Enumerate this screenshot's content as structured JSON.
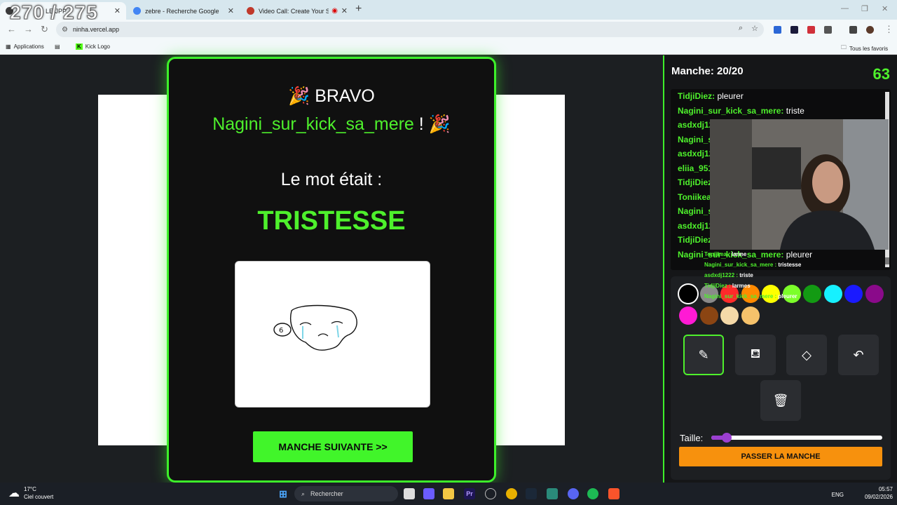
{
  "browser": {
    "overlay_counter": "270 / 275",
    "tabs": [
      {
        "title": "LE JPP",
        "favicon_color": "#3a3a3a"
      },
      {
        "title": "zebre - Recherche Google",
        "favicon_color": "#4285f4"
      },
      {
        "title": "Video Call: Create Your Ser",
        "favicon_color": "#c0392b"
      }
    ],
    "url": "ninha.vercel.app",
    "bookmarks": [
      {
        "label": "Applications",
        "icon": "apps-grid-icon"
      },
      {
        "label": "Kick Logo",
        "icon": "kick-logo-icon"
      }
    ],
    "all_bookmarks": "Tous les favoris"
  },
  "modal": {
    "bravo": "BRAVO",
    "winner": "Nagini_sur_kick_sa_mere",
    "winner_suffix": "!",
    "word_intro": "Le mot était :",
    "word": "TRISTESSE",
    "next_button": "MANCHE SUIVANTE >>"
  },
  "panel": {
    "round": "Manche: 20/20",
    "timer": "63",
    "chat": [
      {
        "user": "TidjiDiez:",
        "text": "pleurer"
      },
      {
        "user": "Nagini_sur_kick_sa_mere:",
        "text": "triste"
      },
      {
        "user": "asdxdj12",
        "text": ""
      },
      {
        "user": "Nagini_s",
        "text": ""
      },
      {
        "user": "asdxdj12",
        "text": ""
      },
      {
        "user": "eliia_951",
        "text": ""
      },
      {
        "user": "TidjiDiez",
        "text": ""
      },
      {
        "user": "Toniikea",
        "text": ""
      },
      {
        "user": "Nagini_s",
        "text": ""
      },
      {
        "user": "asdxdj12",
        "text": ""
      },
      {
        "user": "TidjiDiez",
        "text": ""
      },
      {
        "user": "Nagini_sur_kick_sa_mere:",
        "text": "pleurer"
      }
    ],
    "colors": [
      "#000000",
      "#8a8a8a",
      "#ff2a2a",
      "#ff8a00",
      "#ffff00",
      "#7cff2a",
      "#139a13",
      "#16f1ff",
      "#1a1aff",
      "#8a0a8a",
      "#ff1ad4",
      "#8b4513",
      "#f4d9a8",
      "#f6c26b"
    ],
    "tools": [
      {
        "name": "pencil",
        "icon": "pencil-icon"
      },
      {
        "name": "fill",
        "icon": "paint-bucket-icon"
      },
      {
        "name": "eraser",
        "icon": "eraser-icon"
      },
      {
        "name": "undo",
        "icon": "undo-icon"
      },
      {
        "name": "clear",
        "icon": "trash-icon"
      }
    ],
    "size_label": "Taille:",
    "size_level": 0.06,
    "skip_button": "PASSER LA MANCHE"
  },
  "stream_overlay_chat": [
    {
      "user": "Toniikea :",
      "text": "larme"
    },
    {
      "user": "Nagini_sur_kick_sa_mere :",
      "text": "tristesse"
    },
    {
      "user": "asdxdj1222 :",
      "text": "triste"
    },
    {
      "user": "TidjiDiez :",
      "text": "larmes"
    },
    {
      "user": "Nagini_sur_kick_sa_mere :",
      "text": "pleurer"
    }
  ],
  "taskbar": {
    "weather_temp": "17°C",
    "weather_desc": "Ciel couvert",
    "search": "Rechercher",
    "lang": "ENG",
    "time": "05:57",
    "date": "09/02/2026"
  }
}
